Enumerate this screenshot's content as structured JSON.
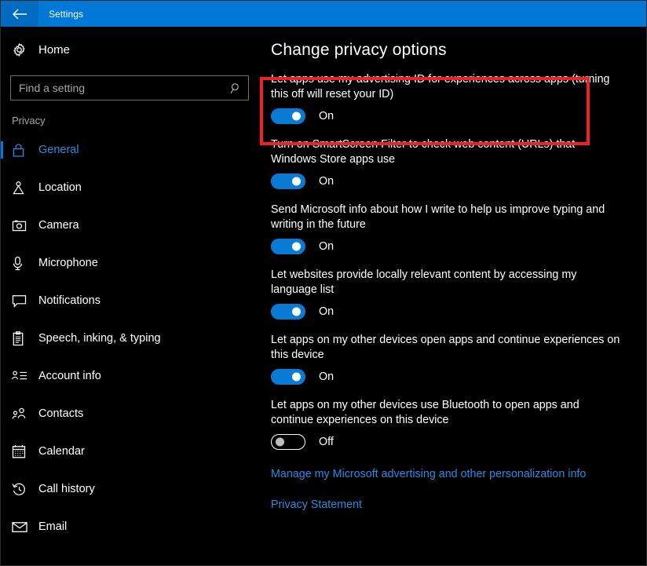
{
  "window": {
    "title": "Settings",
    "back_icon": "back-arrow-icon"
  },
  "colors": {
    "titlebar": "#0078d7",
    "accent": "#0078d7",
    "link": "#2a8ae0",
    "toggle_on": "#0a7bd4",
    "highlight": "#f01f28",
    "background": "#000000"
  },
  "sidebar": {
    "home": {
      "label": "Home",
      "icon": "gear-icon"
    },
    "search": {
      "value": "",
      "placeholder": "Find a setting",
      "icon": "search-icon"
    },
    "section_label": "Privacy",
    "items": [
      {
        "label": "General",
        "icon": "lock-icon",
        "selected": true
      },
      {
        "label": "Location",
        "icon": "location-pin-icon",
        "selected": false
      },
      {
        "label": "Camera",
        "icon": "camera-icon",
        "selected": false
      },
      {
        "label": "Microphone",
        "icon": "microphone-icon",
        "selected": false
      },
      {
        "label": "Notifications",
        "icon": "speech-bubble-icon",
        "selected": false
      },
      {
        "label": "Speech, inking, & typing",
        "icon": "clipboard-icon",
        "selected": false
      },
      {
        "label": "Account info",
        "icon": "account-list-icon",
        "selected": false
      },
      {
        "label": "Contacts",
        "icon": "contacts-icon",
        "selected": false
      },
      {
        "label": "Calendar",
        "icon": "calendar-icon",
        "selected": false
      },
      {
        "label": "Call history",
        "icon": "call-history-icon",
        "selected": false
      },
      {
        "label": "Email",
        "icon": "envelope-icon",
        "selected": false
      }
    ]
  },
  "main": {
    "page_title": "Change privacy options",
    "settings": [
      {
        "description": "Let apps use my advertising ID for experiences across apps (turning this off will reset your ID)",
        "state_label": "On",
        "state": "on",
        "highlighted": true
      },
      {
        "description": "Turn on SmartScreen Filter to check web content (URLs) that Windows Store apps use",
        "state_label": "On",
        "state": "on",
        "highlighted": false
      },
      {
        "description": "Send Microsoft info about how I write to help us improve typing and writing in the future",
        "state_label": "On",
        "state": "on",
        "highlighted": false
      },
      {
        "description": "Let websites provide locally relevant content by accessing my language list",
        "state_label": "On",
        "state": "on",
        "highlighted": false
      },
      {
        "description": "Let apps on my other devices open apps and continue experiences on this device",
        "state_label": "On",
        "state": "on",
        "highlighted": false
      },
      {
        "description": "Let apps on my other devices use Bluetooth to open apps and continue experiences on this device",
        "state_label": "Off",
        "state": "off",
        "highlighted": false
      }
    ],
    "links": [
      {
        "label": "Manage my Microsoft advertising and other personalization info"
      },
      {
        "label": "Privacy Statement"
      }
    ]
  }
}
